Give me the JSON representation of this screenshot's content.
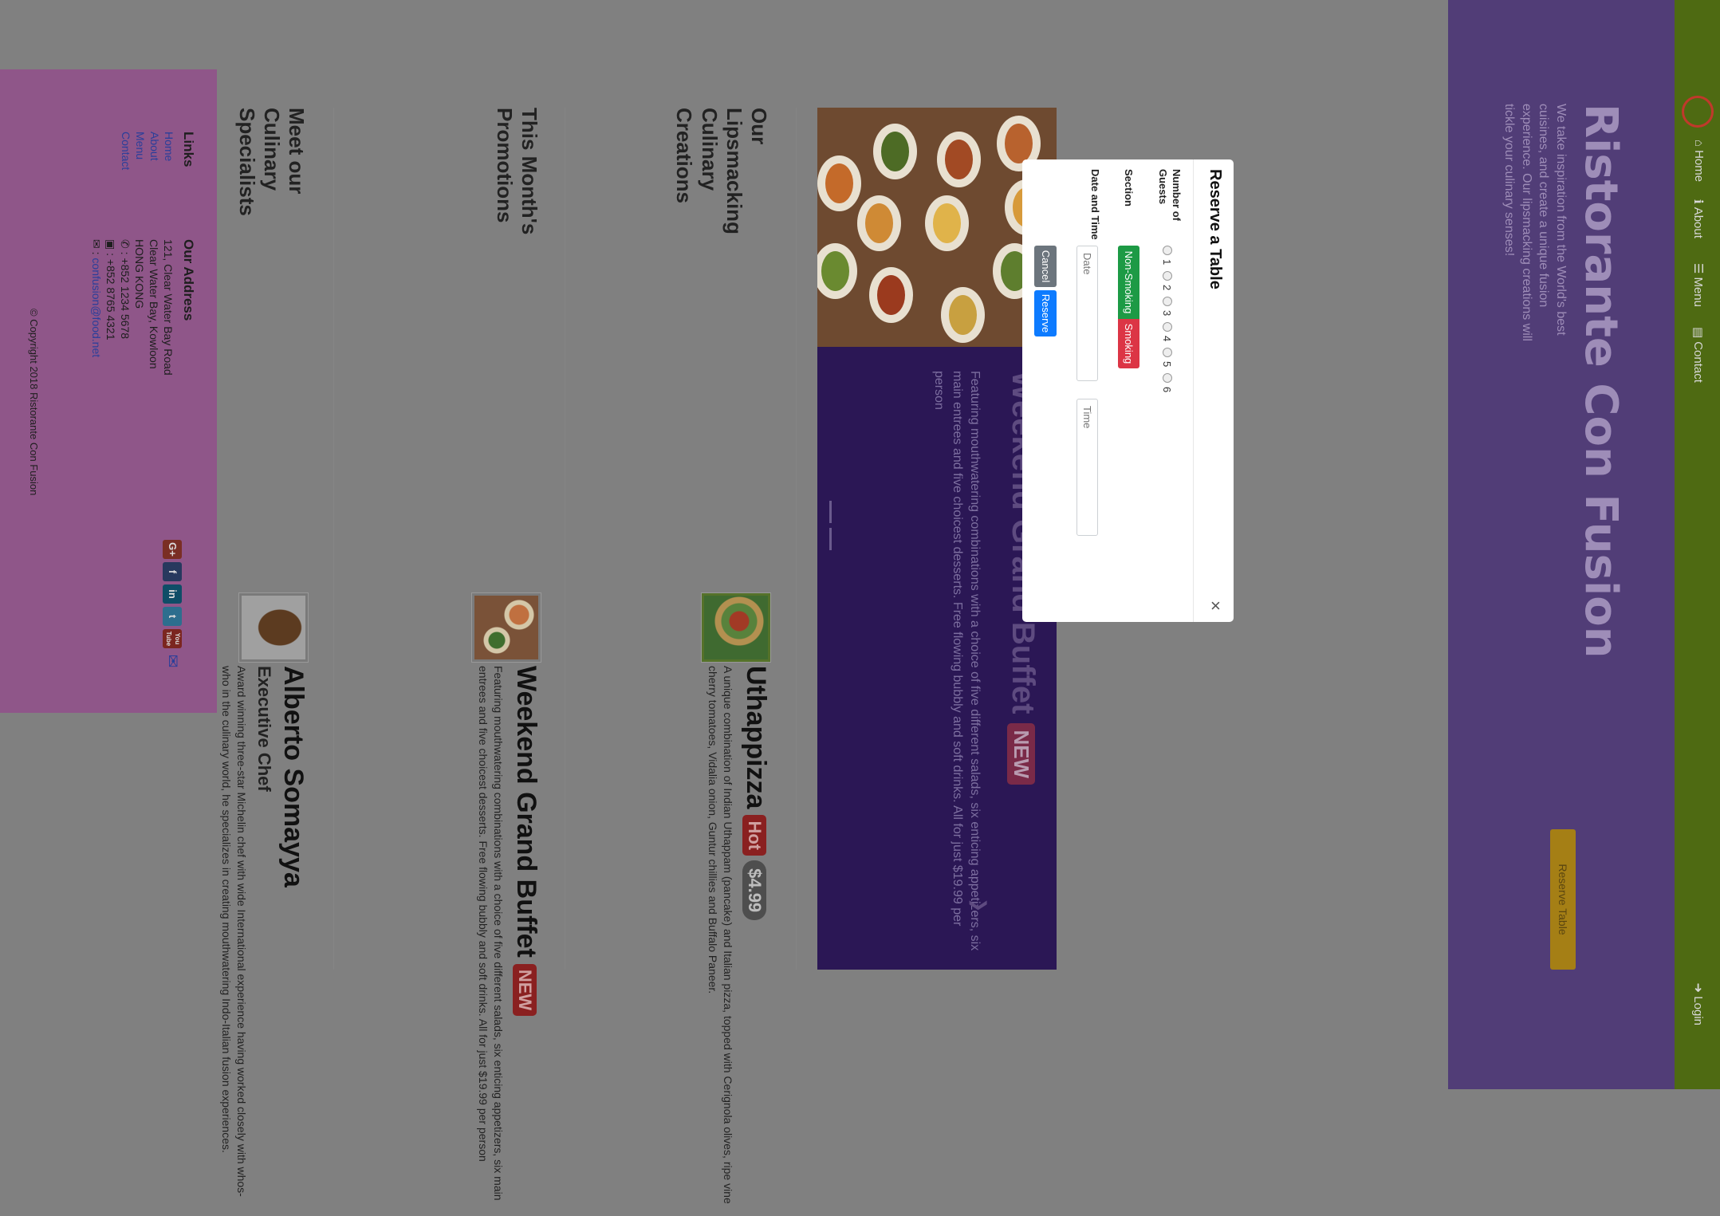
{
  "navbar": {
    "items": [
      {
        "label": "Home",
        "icon": "home-icon"
      },
      {
        "label": "About",
        "icon": "info-icon"
      },
      {
        "label": "Menu",
        "icon": "list-icon"
      },
      {
        "label": "Contact",
        "icon": "address-card-icon"
      }
    ],
    "login_label": "Login"
  },
  "jumbotron": {
    "title": "Ristorante Con Fusion",
    "text": "We take inspiration from the World's best cuisines, and create a unique fusion experience. Our lipsmacking creations will tickle your culinary senses!",
    "reserve_label": "Reserve Table"
  },
  "carousel": {
    "title": "Weekend Grand Buffet",
    "badge": "NEW",
    "text": "Featuring mouthwatering combinations with a choice of five different salads, six enticing appetizers, six main entrees and five choicest desserts. Free flowing bubbly and soft drinks. All for just $19.99 per person"
  },
  "sections": {
    "creations": {
      "heading": "Our Lipsmacking Culinary Creations",
      "title": "Uthappizza",
      "badge": "Hot",
      "price": "$4.99",
      "text": "A unique combination of Indian Uthappam (pancake) and Italian pizza, topped with Cerignola olives, ripe vine cherry tomatoes, Vidalia onion, Guntur chillies and Buffalo Paneer."
    },
    "promotions": {
      "heading": "This Month's Promotions",
      "title": "Weekend Grand Buffet",
      "badge": "NEW",
      "text": "Featuring mouthwatering combinations with a choice of five different salads, six enticing appetizers, six main entrees and five choicest desserts. Free flowing bubbly and soft drinks. All for just $19.99 per person"
    },
    "specialists": {
      "heading": "Meet our Culinary Specialists",
      "title": "Alberto Somayya",
      "subtitle": "Executive Chef",
      "text": "Award winning three-star Michelin chef with wide International experience having worked closely with whos-who in the culinary world, he specializes in creating mouthwatering Indo-Italian fusion experiences."
    }
  },
  "footer": {
    "links_heading": "Links",
    "links": [
      "Home",
      "About",
      "Menu",
      "Contact"
    ],
    "address_heading": "Our Address",
    "address_lines": [
      "121, Clear Water Bay Road",
      "Clear Water Bay, Kowloon",
      "HONG KONG"
    ],
    "phone": "+852 1234 5678",
    "fax": "+852 8765 4321",
    "email": "confusion@food.net",
    "copyright": "© Copyright 2018 Ristorante Con Fusion",
    "social": [
      {
        "label": "G+",
        "color": "#7a2e24"
      },
      {
        "label": "f",
        "color": "#27395e"
      },
      {
        "label": "in",
        "color": "#0f4d67"
      },
      {
        "label": "t",
        "color": "#2d6e8e"
      },
      {
        "label": "You Tube",
        "color": "#7b2620"
      },
      {
        "label": "✉",
        "color": "#8f5689"
      }
    ]
  },
  "modal": {
    "title": "Reserve a Table",
    "close": "×",
    "guests_label": "Number of Guests",
    "guest_options": [
      "1",
      "2",
      "3",
      "4",
      "5",
      "6"
    ],
    "section_label": "Section",
    "section_options": [
      "Non-Smoking",
      "Smoking"
    ],
    "datetime_label": "Date and Time",
    "date_placeholder": "Date",
    "time_placeholder": "Time",
    "cancel_label": "Cancel",
    "reserve_label": "Reserve"
  }
}
